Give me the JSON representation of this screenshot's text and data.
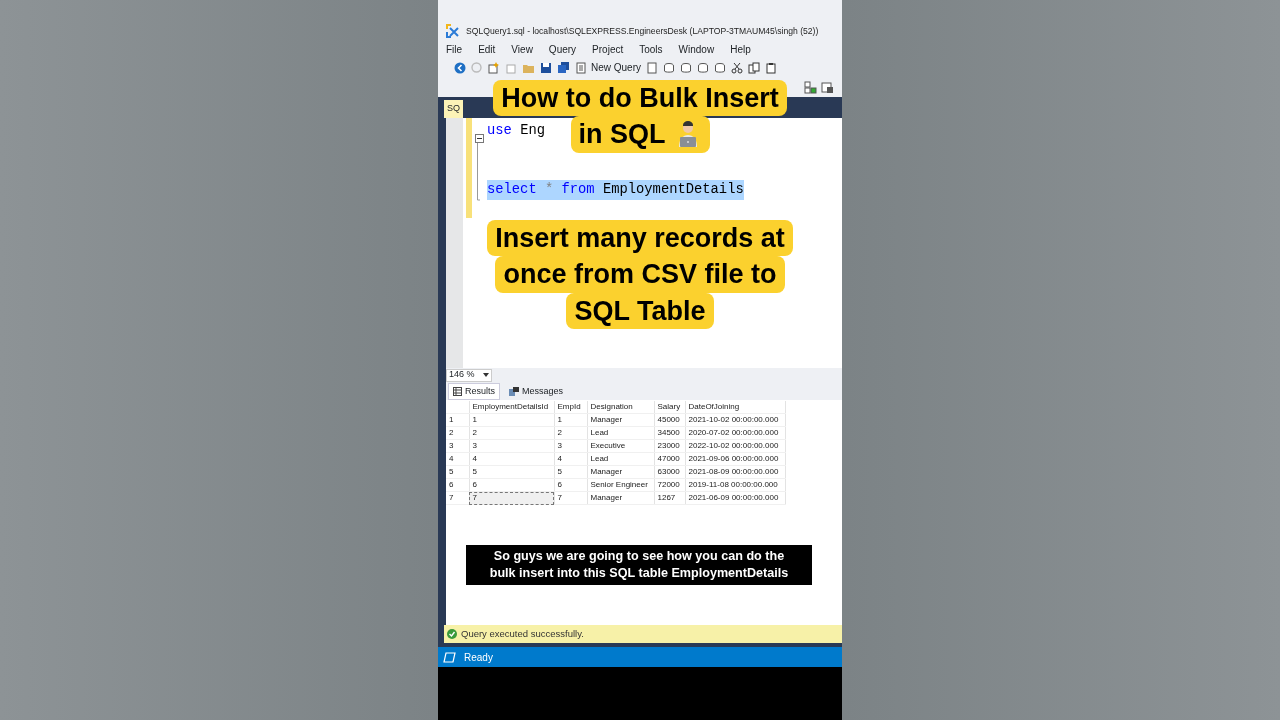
{
  "window": {
    "title": "SQLQuery1.sql - localhost\\SQLEXPRESS.EngineersDesk (LAPTOP-3TMAUM45\\singh (52))"
  },
  "menu": [
    "File",
    "Edit",
    "View",
    "Query",
    "Project",
    "Tools",
    "Window",
    "Help"
  ],
  "toolbar": {
    "new_query": "New Query"
  },
  "editor_tab": {
    "label": "SQ"
  },
  "editor": {
    "lines": [
      {
        "kind": "code",
        "selected": false,
        "tokens": [
          {
            "kind": "keyword",
            "text": "use"
          },
          {
            "kind": "identifier",
            "text": "Eng"
          }
        ]
      },
      {
        "kind": "blank"
      },
      {
        "kind": "blank"
      },
      {
        "kind": "code",
        "selected": true,
        "tokens": [
          {
            "kind": "keyword",
            "text": "select"
          },
          {
            "kind": "operator",
            "text": "*"
          },
          {
            "kind": "keyword",
            "text": "from"
          },
          {
            "kind": "identifier",
            "text": "EmploymentDetails"
          }
        ]
      }
    ]
  },
  "zoom": {
    "value": "146 %"
  },
  "results_tabs": [
    {
      "label": "Results",
      "selected": true
    },
    {
      "label": "Messages",
      "selected": false
    }
  ],
  "table": {
    "columns": [
      "EmploymentDetailsId",
      "EmpId",
      "Designation",
      "Salary",
      "DateOfJoining"
    ],
    "rows": [
      {
        "number": "1",
        "cells": [
          {
            "text": "1",
            "selected": false
          },
          {
            "text": "1",
            "selected": false
          },
          {
            "text": "Manager",
            "selected": false
          },
          {
            "text": "45000",
            "selected": false
          },
          {
            "text": "2021-10-02 00:00:00.000",
            "selected": false
          }
        ]
      },
      {
        "number": "2",
        "cells": [
          {
            "text": "2",
            "selected": false
          },
          {
            "text": "2",
            "selected": false
          },
          {
            "text": "Lead",
            "selected": false
          },
          {
            "text": "34500",
            "selected": false
          },
          {
            "text": "2020-07-02 00:00:00.000",
            "selected": false
          }
        ]
      },
      {
        "number": "3",
        "cells": [
          {
            "text": "3",
            "selected": false
          },
          {
            "text": "3",
            "selected": false
          },
          {
            "text": "Executive",
            "selected": false
          },
          {
            "text": "23000",
            "selected": false
          },
          {
            "text": "2022-10-02 00:00:00.000",
            "selected": false
          }
        ]
      },
      {
        "number": "4",
        "cells": [
          {
            "text": "4",
            "selected": false
          },
          {
            "text": "4",
            "selected": false
          },
          {
            "text": "Lead",
            "selected": false
          },
          {
            "text": "47000",
            "selected": false
          },
          {
            "text": "2021-09-06 00:00:00.000",
            "selected": false
          }
        ]
      },
      {
        "number": "5",
        "cells": [
          {
            "text": "5",
            "selected": false
          },
          {
            "text": "5",
            "selected": false
          },
          {
            "text": "Manager",
            "selected": false
          },
          {
            "text": "63000",
            "selected": false
          },
          {
            "text": "2021-08-09 00:00:00.000",
            "selected": false
          }
        ]
      },
      {
        "number": "6",
        "cells": [
          {
            "text": "6",
            "selected": false
          },
          {
            "text": "6",
            "selected": false
          },
          {
            "text": "Senior Engineer",
            "selected": false
          },
          {
            "text": "72000",
            "selected": false
          },
          {
            "text": "2019-11-08 00:00:00.000",
            "selected": false
          }
        ]
      },
      {
        "number": "7",
        "cells": [
          {
            "text": "7",
            "selected": true
          },
          {
            "text": "7",
            "selected": false
          },
          {
            "text": "Manager",
            "selected": false
          },
          {
            "text": "1267",
            "selected": false
          },
          {
            "text": "2021-06-09 00:00:00.000",
            "selected": false
          }
        ]
      }
    ]
  },
  "query_message": {
    "text": "Query executed successfully."
  },
  "status_bar": {
    "text": "Ready"
  },
  "video_captions": [
    {
      "kind": "title",
      "lines": [
        "How to do Bulk Insert",
        "in SQL"
      ]
    },
    {
      "kind": "subtitle",
      "lines": [
        "Insert many records at",
        "once from CSV file to",
        "SQL Table"
      ]
    }
  ],
  "video_subtitle": {
    "lines": [
      "So guys we are going to see how you can do the",
      "bulk insert into this SQL table EmploymentDetails"
    ]
  }
}
